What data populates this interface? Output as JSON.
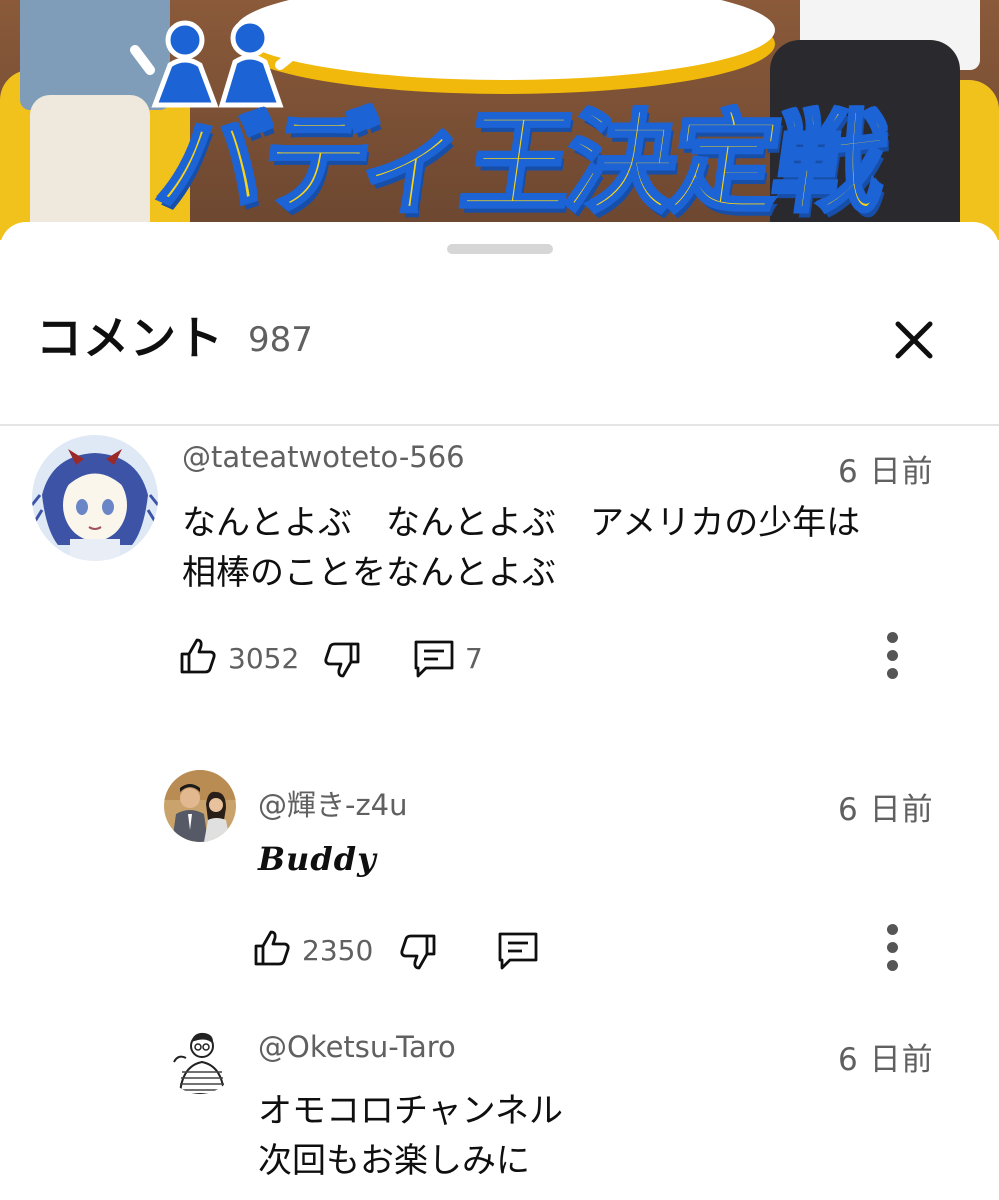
{
  "video": {
    "title_logo": "バディ王決定戦"
  },
  "sheet": {
    "title": "コメント",
    "count": "987"
  },
  "comments": [
    {
      "handle": "@tateatwoteto-566",
      "time": "6 日前",
      "text": "なんとよぶ　なんとよぶ　アメリカの少年は\n相棒のことをなんとよぶ",
      "likes": "3052",
      "replies": "7",
      "avatar_icon": "anime-girl-avatar"
    },
    {
      "handle": "@輝き-z4u",
      "time": "6 日前",
      "text": "Buddy",
      "likes": "2350",
      "avatar_icon": "couple-photo-avatar"
    },
    {
      "handle": "@Oketsu-Taro",
      "time": "6 日前",
      "text": "オモコロチャンネル\n次回もお楽しみに",
      "avatar_icon": "sketch-man-avatar"
    }
  ],
  "colors": {
    "text_primary": "#0f0f0f",
    "text_secondary": "#606060",
    "logo_yellow": "#f7d419",
    "logo_blue": "#1c63d6"
  }
}
